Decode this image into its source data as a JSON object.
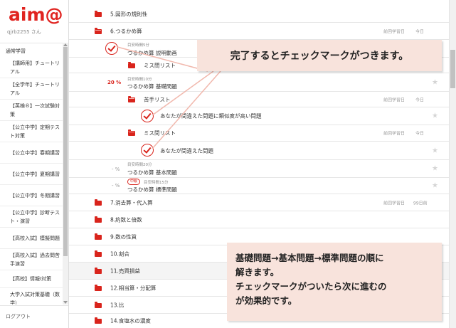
{
  "app": {
    "logo": "aim@",
    "user": "qjrb2255 さん"
  },
  "sidebar": {
    "section": "通常学習",
    "items": [
      "【講師用】チュートリアル",
      "【全学年】チュートリアル",
      "【英検®】一次試験対策",
      "【公立中学】定期テスト対策",
      "【公立中学】春期講習",
      "【公立中学】夏期講習",
      "【公立中学】冬期講習",
      "【公立中学】診断テスト・演習",
      "【高校入試】模擬問題",
      "【高校入試】過去問苦手演習",
      "【高校】情報Ⅰ対策",
      "大学入試対策基礎（数学）"
    ],
    "logout": "ログアウト"
  },
  "main": {
    "rows": {
      "r5": "5.図形の規則性",
      "r6": "6.つるかめ算",
      "r6_meta1": "前回学習日",
      "r6_meta2": "今日",
      "video_small": "目安時間5分",
      "video_name": "つるかめ算 説明動画",
      "miss_list": "ミス問リスト",
      "basic_small": "目安時間10分",
      "basic_pct": "20 %",
      "basic_name": "つるかめ算 基礎問題",
      "weak_list": "苦手リスト",
      "weak_meta1": "前回学習日",
      "weak_meta2": "今日",
      "similar": "あなたが間違えた問題に類似度が高い問題",
      "miss_list2": "ミス問リスト",
      "miss2_meta1": "前回学習日",
      "miss2_meta2": "今日",
      "wrong": "あなたが間違えた問題",
      "std_small": "目安時間20分",
      "std_pct": "- %",
      "std_name": "つるかめ算 基本問題",
      "adv_badge": "中級",
      "adv_small": "目安時間15分",
      "adv_pct": "- %",
      "adv_name": "つるかめ算 標準問題",
      "r7": "7.消去算・代入算",
      "r7_meta1": "前回学習日",
      "r7_meta2": "99日前",
      "r8": "8.約数と倍数",
      "r9": "9.数の性質",
      "r10": "10.割合",
      "r11": "11.売買損益",
      "r12": "12.相当算・分配算",
      "r13": "13.比",
      "r14": "14.食塩水の濃度"
    }
  },
  "callouts": {
    "top": "完了するとチェックマークがつきます。",
    "bottom_1": "基礎問題→基本問題→標準問題の順に",
    "bottom_2": "解きます。",
    "bottom_3": "チェックマークがついたら次に進むの",
    "bottom_4": "が効果的です。"
  },
  "colors": {
    "accent": "#d9241c",
    "callout": "#f8e3dc"
  }
}
